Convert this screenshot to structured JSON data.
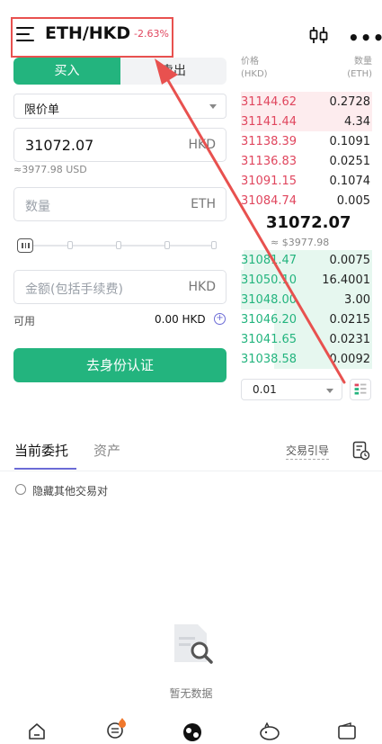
{
  "header": {
    "pair": "ETH/HKD",
    "change": "-2.63%"
  },
  "trade_form": {
    "buy_label": "买入",
    "sell_label": "卖出",
    "order_type": "限价单",
    "price_value": "31072.07",
    "price_unit": "HKD",
    "price_usd_note": "≈3977.98 USD",
    "quantity_placeholder": "数量",
    "quantity_unit": "ETH",
    "amount_placeholder": "金额(包括手续费)",
    "amount_unit": "HKD",
    "available_label": "可用",
    "available_value": "0.00 HKD",
    "slider_percent": 0,
    "verify_button": "去身份认证"
  },
  "order_book": {
    "price_header": "价格\n(HKD)",
    "qty_header": "数量\n(ETH)",
    "asks": [
      {
        "price": "31144.62",
        "qty": "0.2728",
        "depth": 1.0
      },
      {
        "price": "31141.44",
        "qty": "4.34",
        "depth": 1.0
      },
      {
        "price": "31138.39",
        "qty": "0.1091",
        "depth": 0.0
      },
      {
        "price": "31136.83",
        "qty": "0.0251",
        "depth": 0.0
      },
      {
        "price": "31091.15",
        "qty": "0.1074",
        "depth": 0.0
      },
      {
        "price": "31084.74",
        "qty": "0.005",
        "depth": 0.0
      }
    ],
    "last_price": "31072.07",
    "last_price_usd": "≈ $3977.98",
    "bids": [
      {
        "price": "31081.47",
        "qty": "0.0075",
        "depth": 0.98
      },
      {
        "price": "31050.10",
        "qty": "16.4001",
        "depth": 1.0
      },
      {
        "price": "31048.00",
        "qty": "3.00",
        "depth": 1.0
      },
      {
        "price": "31046.20",
        "qty": "0.0215",
        "depth": 0.75
      },
      {
        "price": "31041.65",
        "qty": "0.0231",
        "depth": 0.75
      },
      {
        "price": "31038.58",
        "qty": "0.0092",
        "depth": 0.75
      }
    ],
    "precision": "0.01"
  },
  "orders_section": {
    "tab_open": "当前委托",
    "tab_assets": "资产",
    "guide_label": "交易引导",
    "hide_other_pairs": "隐藏其他交易对",
    "empty_text": "暂无数据"
  },
  "colors": {
    "buy_green": "#23b47e",
    "sell_red": "#e0465e",
    "accent_purple": "#6b6bd6",
    "annotation_red": "#e8514f"
  },
  "icons": {
    "menu": "hamburger-menu-icon",
    "candles": "candlestick-chart-icon",
    "more": "more-dots-icon",
    "order_log": "order-history-icon",
    "nav": [
      "home-icon",
      "market-icon",
      "trade-icon",
      "earn-icon",
      "wallet-icon"
    ]
  }
}
